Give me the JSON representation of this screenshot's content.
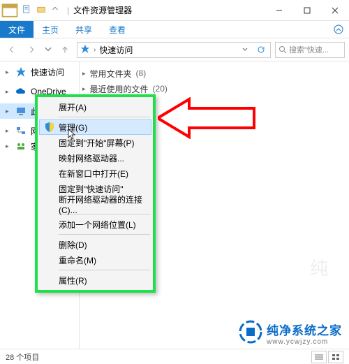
{
  "titlebar": {
    "app_title": "文件资源管理器",
    "separator": "|"
  },
  "ribbon": {
    "file": "文件",
    "home": "主页",
    "share": "共享",
    "view": "查看",
    "help": "?"
  },
  "navbar": {
    "location": "快速访问",
    "search_placeholder": "搜索\"快速..."
  },
  "sidebar": {
    "items": [
      {
        "label": "快速访问",
        "icon": "star"
      },
      {
        "label": "OneDrive",
        "icon": "cloud"
      },
      {
        "label": "此电脑",
        "icon": "pc",
        "selected": true
      },
      {
        "label": "网",
        "icon": "net",
        "truncated": true
      },
      {
        "label": "家",
        "icon": "home",
        "truncated": true
      }
    ]
  },
  "content": {
    "groups": [
      {
        "label": "常用文件夹",
        "count": "(8)"
      },
      {
        "label": "最近使用的文件",
        "count": "(20)"
      }
    ]
  },
  "context_menu": {
    "items": [
      {
        "label": "展开(A)",
        "type": "item"
      },
      {
        "type": "sep"
      },
      {
        "label": "管理(G)",
        "type": "item",
        "icon": "shield",
        "hover": true,
        "cursor": true
      },
      {
        "label": "固定到\"开始\"屏幕(P)",
        "type": "item"
      },
      {
        "label": "映射网络驱动器...",
        "type": "item"
      },
      {
        "label": "在新窗口中打开(E)",
        "type": "item"
      },
      {
        "label": "固定到\"快速访问\"",
        "type": "item"
      },
      {
        "label": "断开网络驱动器的连接(C)...",
        "type": "item"
      },
      {
        "type": "sep"
      },
      {
        "label": "添加一个网络位置(L)",
        "type": "item"
      },
      {
        "type": "sep"
      },
      {
        "label": "删除(D)",
        "type": "item"
      },
      {
        "label": "重命名(M)",
        "type": "item"
      },
      {
        "type": "sep"
      },
      {
        "label": "属性(R)",
        "type": "item"
      }
    ]
  },
  "statusbar": {
    "item_count": "28 个项目"
  },
  "watermark": {
    "main": "纯净系统之家",
    "sub": "www.ycwjzy.com"
  },
  "colors": {
    "accent": "#1979ca",
    "highlight_border": "#1fe04a",
    "arrow": "#ff0000"
  }
}
